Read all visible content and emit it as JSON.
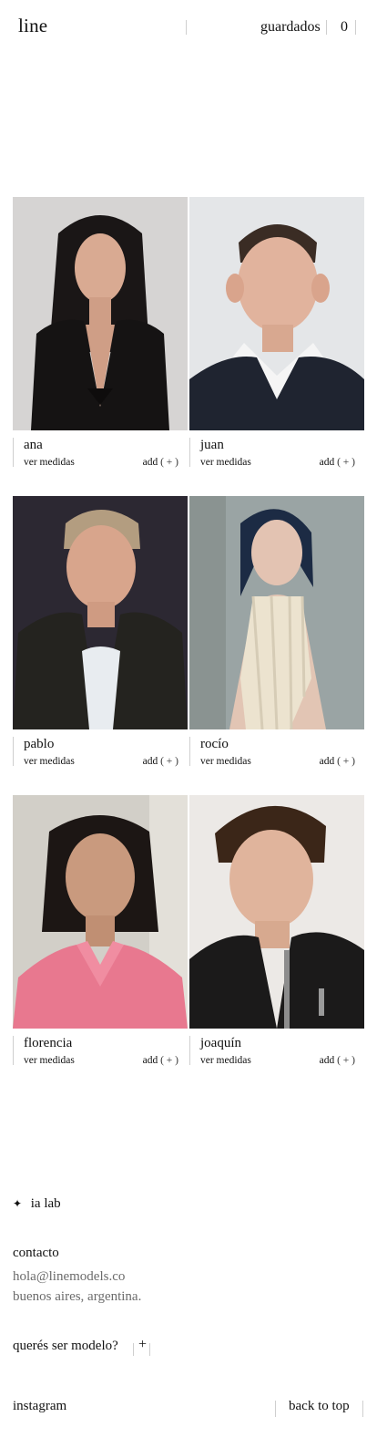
{
  "header": {
    "logo": "line",
    "saved_label": "guardados",
    "saved_count": "0"
  },
  "models": [
    {
      "name": "ana",
      "measures_label": "ver medidas",
      "add_label": "add",
      "add_symbol": "( + )"
    },
    {
      "name": "juan",
      "measures_label": "ver medidas",
      "add_label": "add",
      "add_symbol": "( + )"
    },
    {
      "name": "pablo",
      "measures_label": "ver medidas",
      "add_label": "add",
      "add_symbol": "( + )"
    },
    {
      "name": "rocío",
      "measures_label": "ver medidas",
      "add_label": "add",
      "add_symbol": "( + )"
    },
    {
      "name": "florencia",
      "measures_label": "ver medidas",
      "add_label": "add",
      "add_symbol": "( + )"
    },
    {
      "name": "joaquín",
      "measures_label": "ver medidas",
      "add_label": "add",
      "add_symbol": "( + )"
    }
  ],
  "lab": {
    "icon": "sparkle-icon",
    "label": "ia lab"
  },
  "contact": {
    "heading": "contacto",
    "email": "hola@linemodels.co",
    "location": "buenos aires, argentina."
  },
  "cta": {
    "label": "querés ser modelo?",
    "symbol": "+"
  },
  "footer": {
    "instagram": "instagram",
    "back_to_top": "back to top"
  },
  "colors": {
    "text": "#111111",
    "muted": "#6b6b6b",
    "separator": "#cfcfcf",
    "background": "#ffffff"
  }
}
